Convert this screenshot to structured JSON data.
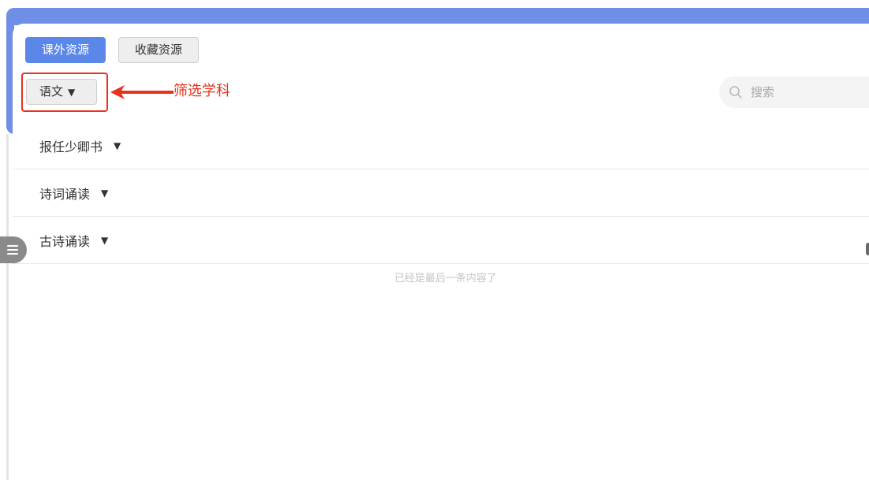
{
  "tabs": [
    {
      "label": "课外资源",
      "active": true
    },
    {
      "label": "收藏资源",
      "active": false
    }
  ],
  "subject_filter": {
    "selected": "语文",
    "caret": "▼"
  },
  "annotation": {
    "label": "筛选学科",
    "color": "#e8321d"
  },
  "search": {
    "placeholder": "搜索",
    "icon": "search-icon"
  },
  "list": [
    {
      "title": "报任少卿书",
      "caret": "▼"
    },
    {
      "title": "诗词诵读",
      "caret": "▼"
    },
    {
      "title": "古诗诵读",
      "caret": "▼"
    }
  ],
  "end_message": "已经是最后一条内容了",
  "colors": {
    "accent": "#5b88e8",
    "header_band": "#6f8fe6",
    "annotation_red": "#e8321d"
  }
}
